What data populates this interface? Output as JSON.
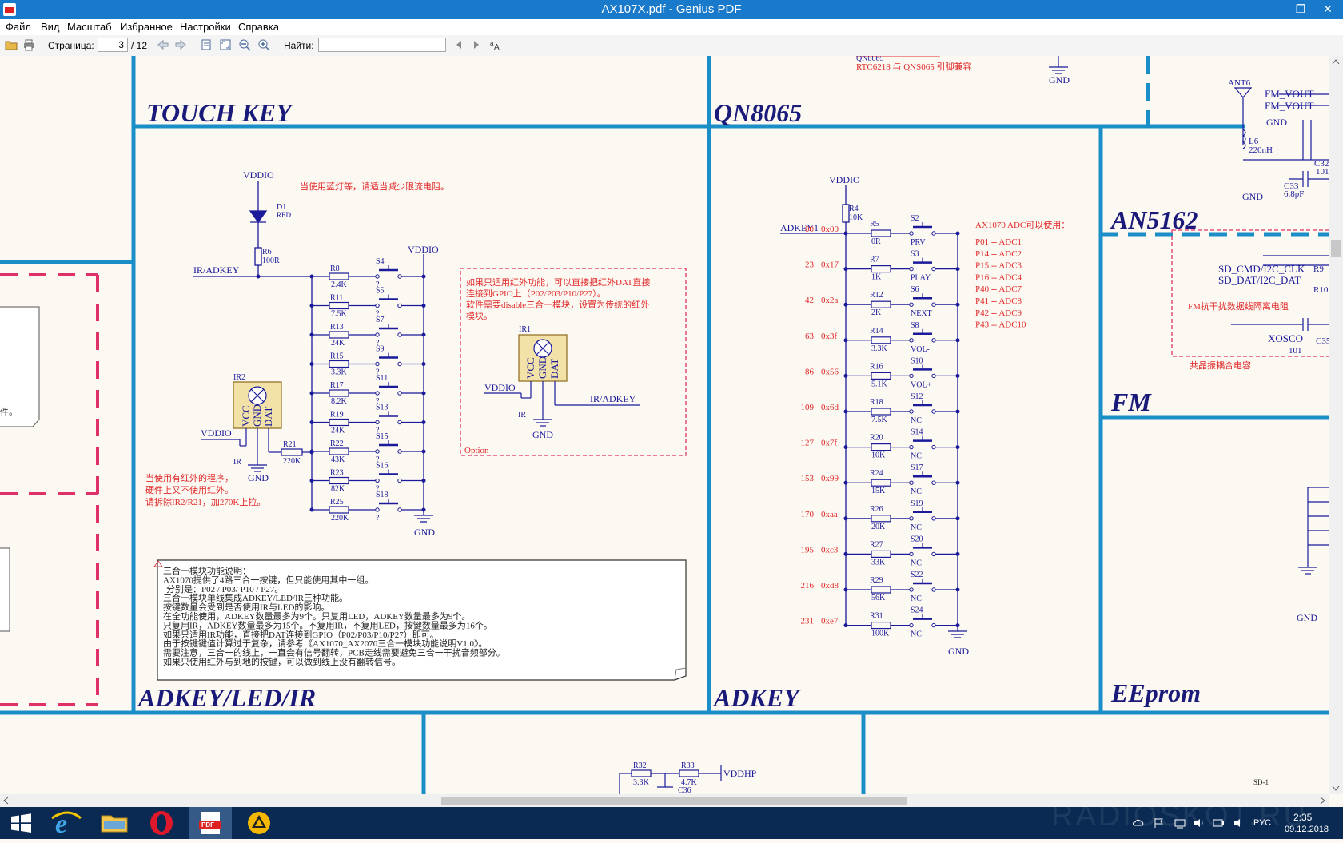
{
  "window": {
    "title": "AX107X.pdf - Genius PDF",
    "minimize": "—",
    "maximize": "❐",
    "close": "✕"
  },
  "menu": [
    "Файл",
    "Вид",
    "Масштаб",
    "Избранное",
    "Настройки",
    "Справка"
  ],
  "toolbar": {
    "page_label": "Страница:",
    "page_value": "3",
    "page_total": "/ 12",
    "find_label": "Найти:",
    "find_value": ""
  },
  "schematic": {
    "section_titles": {
      "touch_key": "TOUCH KEY",
      "qn8065": "QN8065",
      "an5162": "AN5162",
      "fm": "FM",
      "adkey_led_ir": "ADKEY/LED/IR",
      "adkey": "ADKEY",
      "eeprom": "EEprom"
    },
    "top": {
      "qn8065_note1": "QN8065",
      "qn8065_note2": "RTC6218 与 QNS065 引脚兼容",
      "gnd": "GND"
    },
    "right": {
      "ant": "ANT6",
      "fm_vout1": "FM_VOUT",
      "fm_vout2": "FM_VOUT",
      "gnd1": "GND",
      "l6": "L6",
      "l6_val": "220nH",
      "c32": "C32",
      "c32_val": "101",
      "c33": "C33",
      "c33_val": "6.8pF",
      "gnd2": "GND",
      "sd_cmd": "SD_CMD/I2C_CLK",
      "sd_dat": "SD_DAT/I2C_DAT",
      "r9": "R9",
      "r10": "R10",
      "fm_note": "FM抗干扰数据线隔离电阻",
      "xosco": "XOSCO",
      "c35": "C35",
      "c35_val": "101",
      "crystal_note": "共晶振耦合电容",
      "gnd3": "GND"
    },
    "left": {
      "partial_text": "件。"
    },
    "touch": {
      "vddio_led": "VDDIO",
      "led_note": "当使用蓝灯等，请适当减少限流电阻。",
      "d1": "D1",
      "d1_val": "RED",
      "r6": "R6",
      "r6_val": "100R",
      "ir_adkey": "IR/ADKEY",
      "vddio_sw": "VDDIO",
      "resistors": [
        {
          "ref": "R8",
          "val": "2.4K",
          "sw": "S4"
        },
        {
          "ref": "R11",
          "val": "7.5K",
          "sw": "S5"
        },
        {
          "ref": "R13",
          "val": "24K",
          "sw": "S7"
        },
        {
          "ref": "R15",
          "val": "3.3K",
          "sw": "S9"
        },
        {
          "ref": "R17",
          "val": "8.2K",
          "sw": "S11"
        },
        {
          "ref": "R19",
          "val": "24K",
          "sw": "S13"
        },
        {
          "ref": "R22",
          "val": "43K",
          "sw": "S15"
        },
        {
          "ref": "R23",
          "val": "82K",
          "sw": "S16"
        },
        {
          "ref": "R25",
          "val": "220K",
          "sw": "S18"
        }
      ],
      "gnd_sw": "GND",
      "ir2": "IR2",
      "vcc": "VCC",
      "gnd_pin": "GND",
      "dat": "DAT",
      "vddio_ir2": "VDDIO",
      "ir_label": "IR",
      "r21": "R21",
      "r21_val": "220K",
      "gnd_ir2": "GND",
      "ir_note": [
        "当使用有红外的程序，",
        "硬件上又不使用红外。",
        "请拆除IR2/R21，加270K上拉。"
      ],
      "opt_note": [
        "如果只适用红外功能，可以直接把红外DAT直接",
        "连接到GPIO上（P02/P03/P10/P27）。",
        "软件需要disable三合一模块，设置为传统的红外",
        "模块。"
      ],
      "ir1": "IR1",
      "vddio_ir1": "VDDIO",
      "ir1_label": "IR",
      "ir1_out": "IR/ADKEY",
      "gnd_ir1": "GND",
      "option": "Option",
      "note_lines": [
        "三合一模块功能说明：",
        "AX1070提供了4路三合一按键，但只能使用其中一组。",
        "分别是：P02 / P03/ P10 / P27。",
        "三合一模块单线集成ADKEY/LED/IR三种功能。",
        "按键数量会受到是否使用IR与LED的影响。",
        "在全功能使用，ADKEY数量最多为9个。只复用LED，ADKEY数量最多为9个。",
        "只复用IR，ADKEY数量最多为15个。不复用IR，不复用LED，按键数量最多为16个。",
        "如果只适用IR功能，直接把DAT连接到GPIO（P02/P03/P10/P27）即可。",
        "由于按键键值计算过于复杂，请参考《AX1070_AX2070三合一模块功能说明V1.0》。",
        "需要注意，三合一的线上，一直会有信号翻转，PCB走线需要避免三合一干扰音频部分。",
        "如果只使用红外与到地的按键，可以做到线上没有翻转信号。"
      ]
    },
    "adkey": {
      "vddio": "VDDIO",
      "r4": "R4",
      "r4_val": "10K",
      "label": "ADKEY1",
      "rows": [
        {
          "adc": "00",
          "hex": "0x00",
          "r": "R5",
          "rv": "0R",
          "s": "S2",
          "f": "PRV"
        },
        {
          "adc": "23",
          "hex": "0x17",
          "r": "R7",
          "rv": "1K",
          "s": "S3",
          "f": "PLAY"
        },
        {
          "adc": "42",
          "hex": "0x2a",
          "r": "R12",
          "rv": "2K",
          "s": "S6",
          "f": "NEXT"
        },
        {
          "adc": "63",
          "hex": "0x3f",
          "r": "R14",
          "rv": "3.3K",
          "s": "S8",
          "f": "VOL-"
        },
        {
          "adc": "86",
          "hex": "0x56",
          "r": "R16",
          "rv": "5.1K",
          "s": "S10",
          "f": "VOL+"
        },
        {
          "adc": "109",
          "hex": "0x6d",
          "r": "R18",
          "rv": "7.5K",
          "s": "S12",
          "f": "NC"
        },
        {
          "adc": "127",
          "hex": "0x7f",
          "r": "R20",
          "rv": "10K",
          "s": "S14",
          "f": "NC"
        },
        {
          "adc": "153",
          "hex": "0x99",
          "r": "R24",
          "rv": "15K",
          "s": "S17",
          "f": "NC"
        },
        {
          "adc": "170",
          "hex": "0xaa",
          "r": "R26",
          "rv": "20K",
          "s": "S19",
          "f": "NC"
        },
        {
          "adc": "195",
          "hex": "0xc3",
          "r": "R27",
          "rv": "33K",
          "s": "S20",
          "f": "NC"
        },
        {
          "adc": "216",
          "hex": "0xd8",
          "r": "R29",
          "rv": "56K",
          "s": "S22",
          "f": "NC"
        },
        {
          "adc": "231",
          "hex": "0xe7",
          "r": "R31",
          "rv": "100K",
          "s": "S24",
          "f": "NC"
        }
      ],
      "gnd": "GND",
      "adc_title": "AX1070 ADC可以使用：",
      "adc_list": [
        "P01 -- ADC1",
        "P14 -- ADC2",
        "P15 -- ADC3",
        "P16 -- ADC4",
        "P40 -- ADC7",
        "P41 -- ADC8",
        "P42 -- ADC9",
        "P43 -- ADC10"
      ]
    },
    "bottom": {
      "r32": "R32",
      "r32_val": "3.3K",
      "r33": "R33",
      "r33_val": "4.7K",
      "vddhp": "VDDHP",
      "c36": "C36",
      "sd1": "SD-1"
    }
  },
  "taskbar": {
    "lang": "РУС",
    "time": "2:35",
    "date": "09.12.2018",
    "watermark": "RADIOSKOT.RU"
  },
  "colors": {
    "title_bar": "#1979ca",
    "border_blue": "#1a8fc7",
    "section_title": "#1a1a7a",
    "wire": "#1a1a9a",
    "annotation_red": "#e02a2a",
    "dashed_pink": "#e0306a",
    "taskbar": "#0a2a53"
  }
}
